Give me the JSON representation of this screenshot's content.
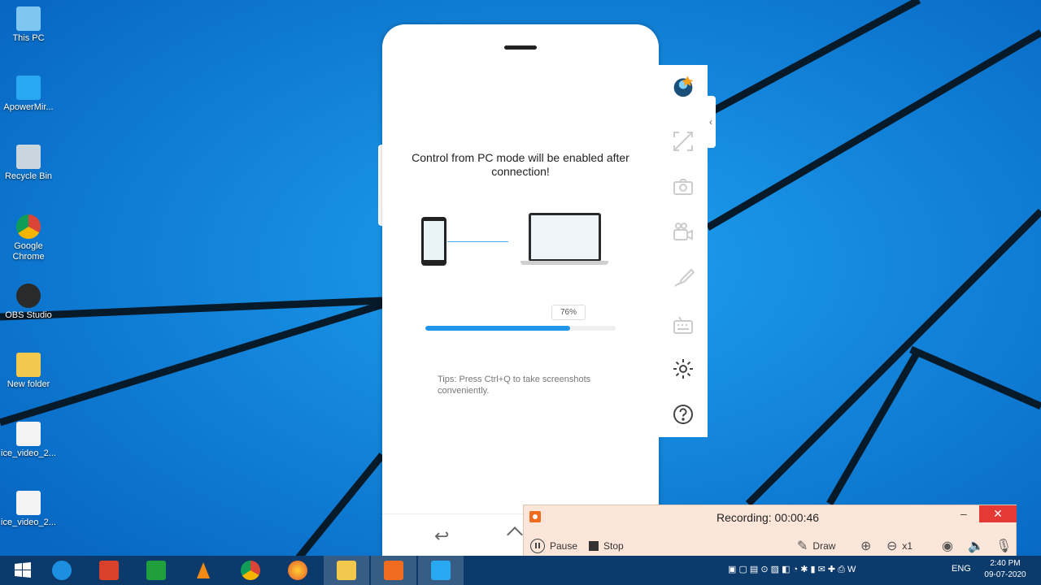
{
  "desktop": {
    "icons": [
      {
        "label": "This PC"
      },
      {
        "label": "ApowerMir..."
      },
      {
        "label": "Recycle Bin"
      },
      {
        "label": "Google\nChrome"
      },
      {
        "label": "OBS Studio"
      },
      {
        "label": "New folder"
      },
      {
        "label": "ice_video_2..."
      },
      {
        "label": "ice_video_2..."
      }
    ]
  },
  "phone": {
    "headline": "Control from PC mode will be enabled after connection!",
    "progress_label": "76%",
    "progress_value": 0.76,
    "tips": "Tips: Press Ctrl+Q to take screenshots conveniently."
  },
  "sidebar": {
    "items": [
      "avatar",
      "fullscreen-icon",
      "camera-icon",
      "video-camera-icon",
      "brush-icon",
      "keyboard-icon",
      "gear-icon",
      "help-icon"
    ]
  },
  "recorder": {
    "title": "Recording:  00:00:46",
    "minimize": "–",
    "close": "✕",
    "pause_label": "Pause",
    "stop_label": "Stop",
    "draw_label": "Draw",
    "zoom_level": "x1"
  },
  "taskbar": {
    "lang": "ENG",
    "time": "2:40 PM",
    "date": "09-07-2020"
  },
  "colors": {
    "accent": "#2196e8",
    "rec_bg": "#fbe6d9",
    "close_red": "#e53935",
    "taskbar": "#0c3a6a"
  }
}
